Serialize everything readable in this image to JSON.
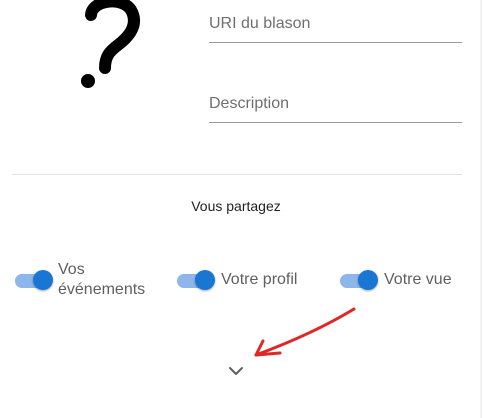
{
  "form": {
    "emblem_uri_label": "URI du blason",
    "description_label": "Description"
  },
  "sharing": {
    "title": "Vous partagez",
    "toggles": [
      {
        "label": "Vos événements",
        "enabled": true
      },
      {
        "label": "Votre profil",
        "enabled": true
      },
      {
        "label": "Votre vue",
        "enabled": true
      }
    ]
  },
  "icons": {
    "emblem": "question-mark-icon",
    "expand": "chevron-down-icon",
    "annotation": "red-arrow-icon"
  },
  "colors": {
    "toggle_thumb": "#1976d2",
    "toggle_track": "#8fb6ea",
    "annotation": "#e12626",
    "divider": "#e3e3e3"
  }
}
